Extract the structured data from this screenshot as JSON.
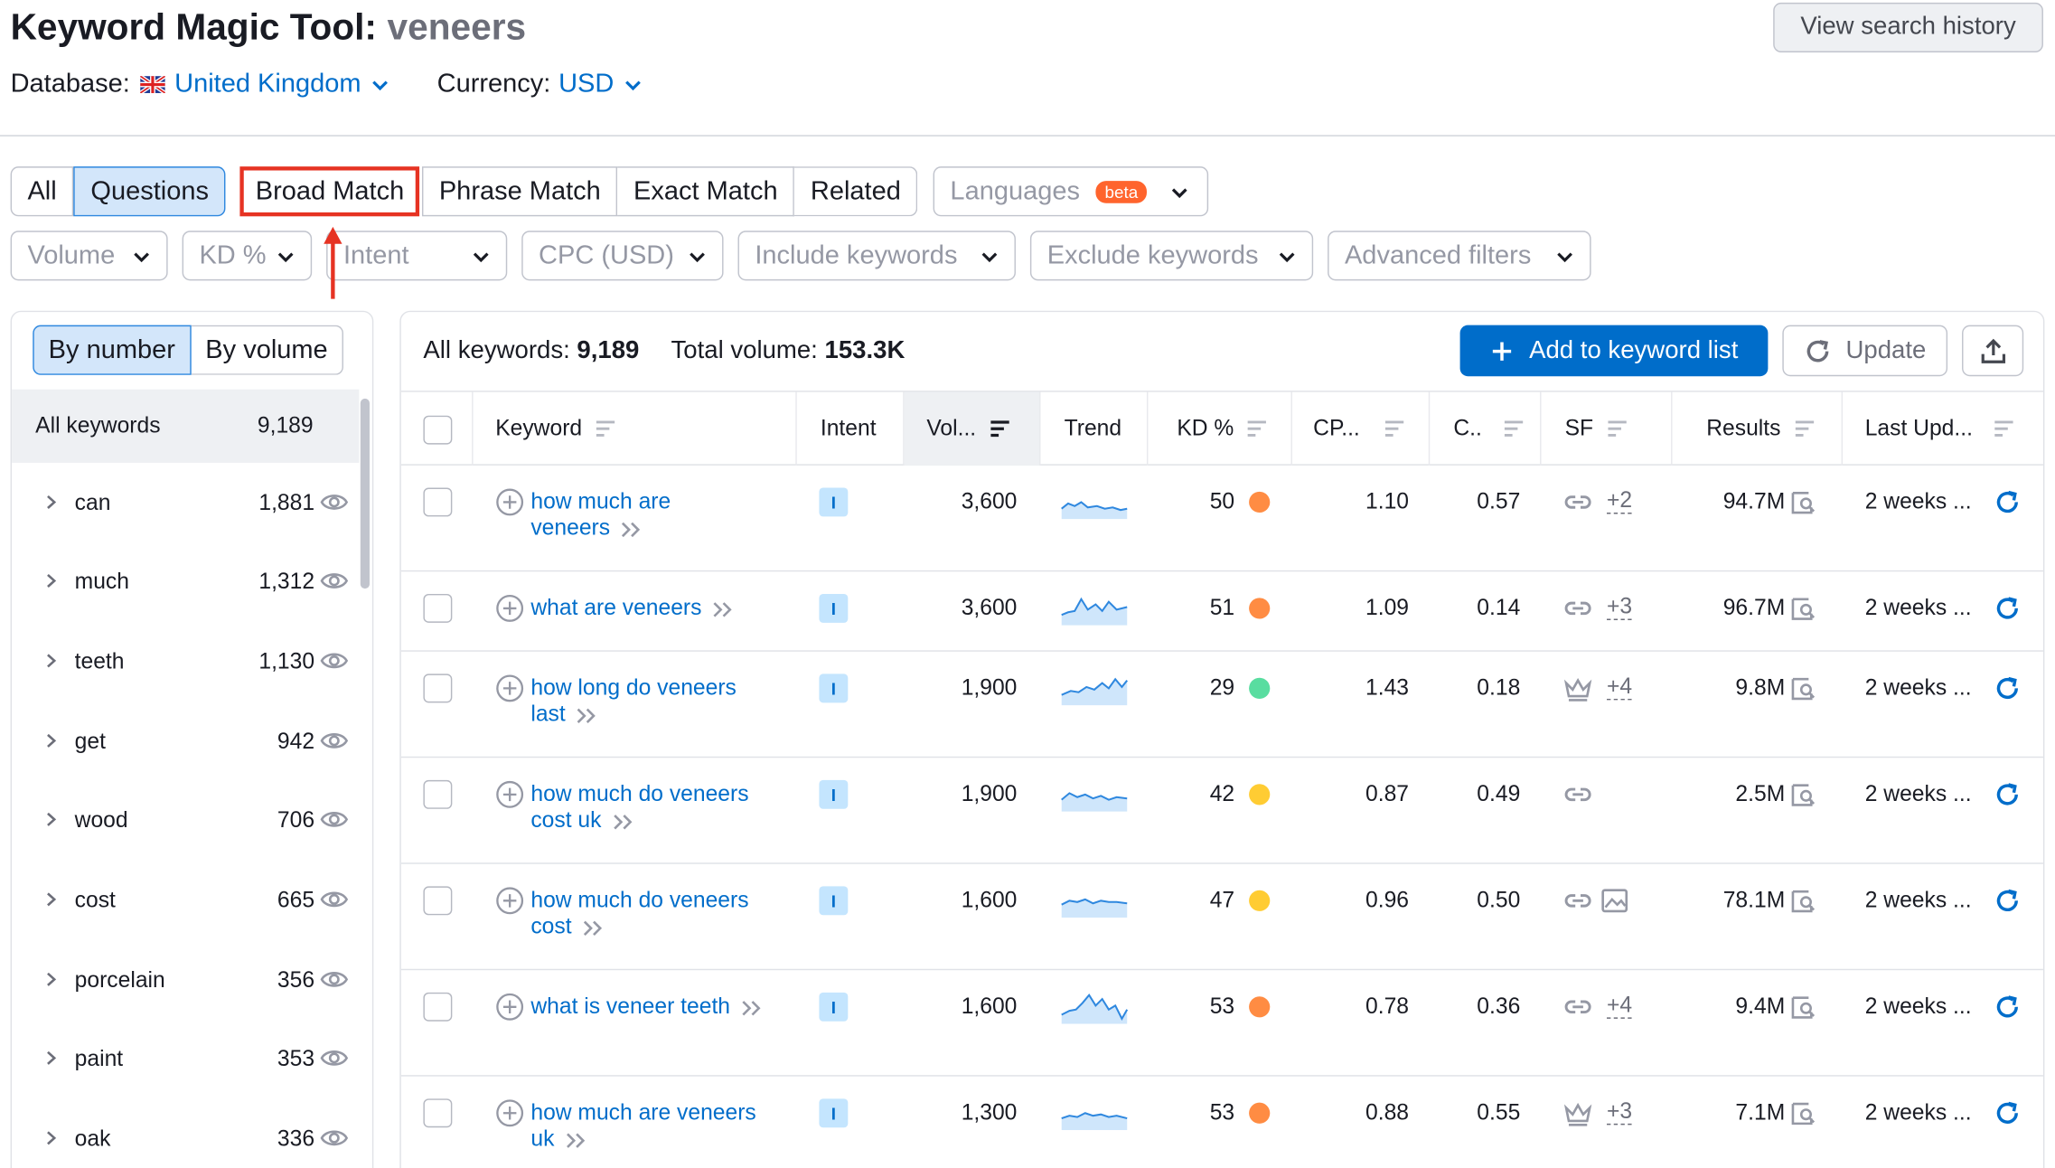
{
  "header": {
    "title_prefix": "Keyword Magic Tool:",
    "query": "veneers",
    "database_label": "Database:",
    "database_value": "United Kingdom",
    "currency_label": "Currency:",
    "currency_value": "USD",
    "view_history": "View search history"
  },
  "tabs": [
    "All",
    "Questions",
    "Broad Match",
    "Phrase Match",
    "Exact Match",
    "Related"
  ],
  "languages": {
    "label": "Languages",
    "badge": "beta"
  },
  "filters": [
    "Volume",
    "KD %",
    "Intent",
    "CPC (USD)",
    "Include keywords",
    "Exclude keywords",
    "Advanced filters"
  ],
  "groups_panel": {
    "by_number": "By number",
    "by_volume": "By volume",
    "all_label": "All keywords",
    "all_count": "9,189",
    "groups": [
      {
        "name": "can",
        "count": "1,881"
      },
      {
        "name": "much",
        "count": "1,312"
      },
      {
        "name": "teeth",
        "count": "1,130"
      },
      {
        "name": "get",
        "count": "942"
      },
      {
        "name": "wood",
        "count": "706"
      },
      {
        "name": "cost",
        "count": "665"
      },
      {
        "name": "porcelain",
        "count": "356"
      },
      {
        "name": "paint",
        "count": "353"
      },
      {
        "name": "oak",
        "count": "336"
      }
    ]
  },
  "summary": {
    "all_label": "All keywords:",
    "all_value": "9,189",
    "vol_label": "Total volume:",
    "vol_value": "153.3K"
  },
  "actions": {
    "add": "Add to keyword list",
    "update": "Update"
  },
  "columns": [
    "Keyword",
    "Intent",
    "Vol...",
    "Trend",
    "KD %",
    "CP...",
    "C..",
    "SF",
    "Results",
    "Last Upd..."
  ],
  "colors": {
    "accent": "#006dca",
    "kd_orange": "#ff8c43",
    "kd_green": "#59dda0",
    "kd_yellow": "#ffcc33",
    "highlight": "#e63323"
  },
  "rows": [
    {
      "kw1": "how much are",
      "kw2": "veneers",
      "intent": "I",
      "volume": "3,600",
      "kd": "50",
      "kd_color": "#ff8c43",
      "cpc": "1.10",
      "com": "0.57",
      "sf_icon": "link-icon",
      "sf_more": "+2",
      "results": "94.7M",
      "updated": "2 weeks ..."
    },
    {
      "kw1": "what are veneers",
      "kw2": "",
      "intent": "I",
      "volume": "3,600",
      "kd": "51",
      "kd_color": "#ff8c43",
      "cpc": "1.09",
      "com": "0.14",
      "sf_icon": "link-icon",
      "sf_more": "+3",
      "results": "96.7M",
      "updated": "2 weeks ..."
    },
    {
      "kw1": "how long do veneers",
      "kw2": "last",
      "intent": "I",
      "volume": "1,900",
      "kd": "29",
      "kd_color": "#59dda0",
      "cpc": "1.43",
      "com": "0.18",
      "sf_icon": "crown-icon",
      "sf_more": "+4",
      "results": "9.8M",
      "updated": "2 weeks ..."
    },
    {
      "kw1": "how much do veneers",
      "kw2": "cost uk",
      "intent": "I",
      "volume": "1,900",
      "kd": "42",
      "kd_color": "#ffcc33",
      "cpc": "0.87",
      "com": "0.49",
      "sf_icon": "link-icon",
      "sf_more": "",
      "results": "2.5M",
      "updated": "2 weeks ..."
    },
    {
      "kw1": "how much do veneers",
      "kw2": "cost",
      "intent": "I",
      "volume": "1,600",
      "kd": "47",
      "kd_color": "#ffcc33",
      "cpc": "0.96",
      "com": "0.50",
      "sf_icon": "link-icon",
      "sf_more": "",
      "results": "78.1M",
      "updated": "2 weeks ..."
    },
    {
      "kw1": "what is veneer teeth",
      "kw2": "",
      "intent": "I",
      "volume": "1,600",
      "kd": "53",
      "kd_color": "#ff8c43",
      "cpc": "0.78",
      "com": "0.36",
      "sf_icon": "link-icon",
      "sf_more": "+4",
      "results": "9.4M",
      "updated": "2 weeks ..."
    },
    {
      "kw1": "how much are veneers",
      "kw2": "uk",
      "intent": "I",
      "volume": "1,300",
      "kd": "53",
      "kd_color": "#ff8c43",
      "cpc": "0.88",
      "com": "0.55",
      "sf_icon": "crown-icon",
      "sf_more": "+3",
      "results": "7.1M",
      "updated": "2 weeks ..."
    }
  ]
}
